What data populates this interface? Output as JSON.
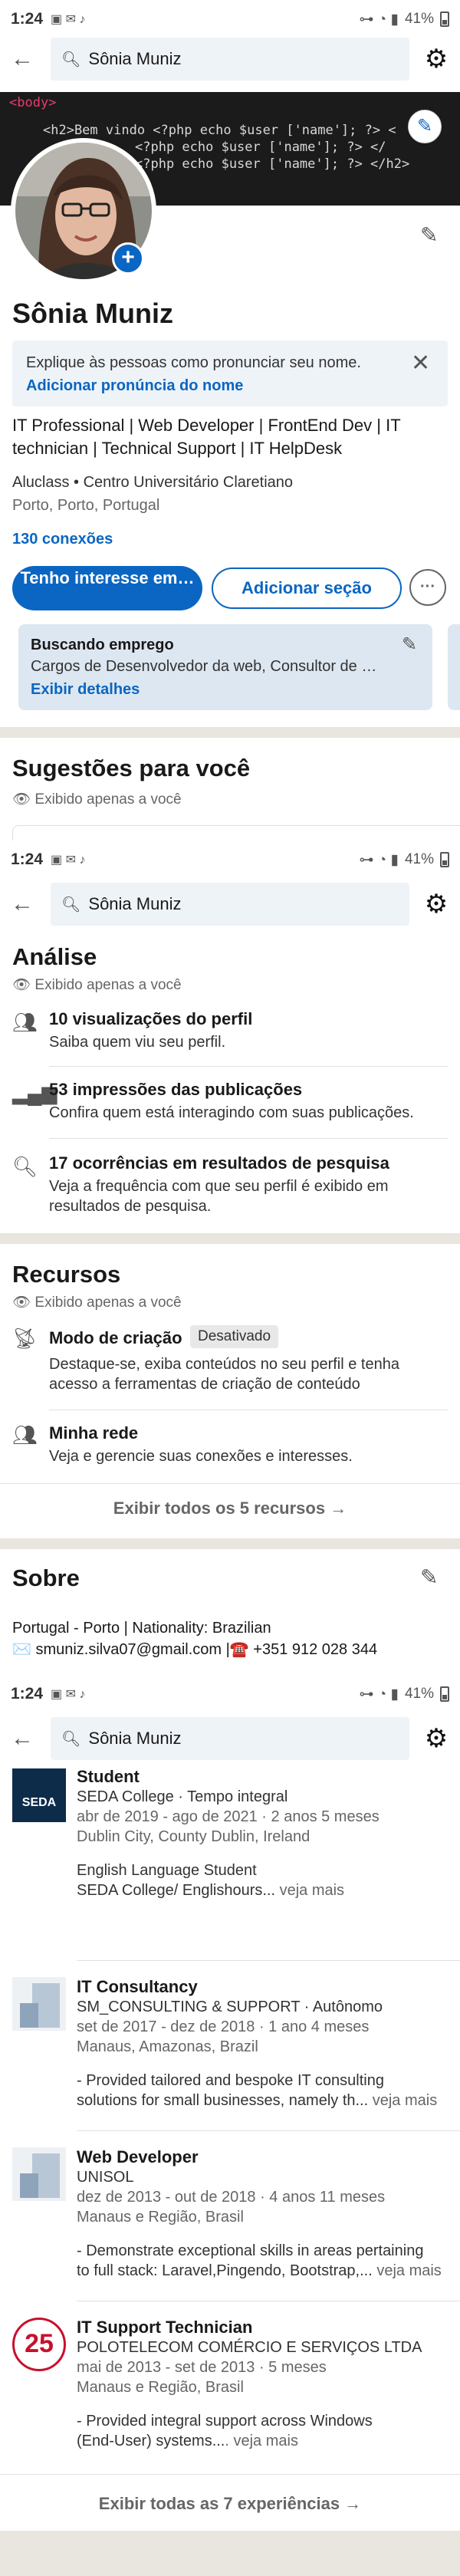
{
  "status_bars": [
    {
      "time": "1:24",
      "battery": "41%"
    },
    {
      "time": "1:24",
      "battery": "41%"
    },
    {
      "time": "1:24",
      "battery": "41%"
    }
  ],
  "search": {
    "value": "Sônia Muniz"
  },
  "cover": {
    "tag": "<body>",
    "lines": [
      "<h2>Bem vindo <?php echo $user ['name']; ?> <",
      "<?php echo $user ['name']; ?> </",
      "<?php echo $user ['name']; ?> </h2>"
    ]
  },
  "profile": {
    "name": "Sônia Muniz",
    "pronunciation_prompt": "Explique às pessoas como pronunciar seu nome.",
    "pronunciation_link": "Adicionar pronúncia do nome",
    "headline": "IT Professional | Web Developer | FrontEnd Dev | IT technician | Technical Support | IT HelpDesk",
    "education": "Aluclass • Centro Universitário Claretiano",
    "location": "Porto, Porto, Portugal",
    "connections": "130 conexões",
    "btn_interest": "Tenho interesse em…",
    "btn_add_section": "Adicionar seção",
    "btn_more": "···"
  },
  "open_to_work": {
    "title": "Buscando emprego",
    "roles": "Cargos de Desenvolvedor da web, Consultor de …",
    "details": "Exibir detalhes"
  },
  "suggestions": {
    "title": "Sugestões para você",
    "visibility": "Exibido apenas a você"
  },
  "analytics": {
    "title": "Análise",
    "visibility": "Exibido apenas a você",
    "items": [
      {
        "title": "10 visualizações do perfil",
        "desc": "Saiba quem viu seu perfil."
      },
      {
        "title": "53 impressões das publicações",
        "desc": "Confira quem está interagindo com suas publicações."
      },
      {
        "title": "17 ocorrências em resultados de pesquisa",
        "desc": "Veja a frequência com que seu perfil é exibido em resultados de pesquisa."
      }
    ]
  },
  "resources": {
    "title": "Recursos",
    "visibility": "Exibido apenas a você",
    "creator_title": "Modo de criação",
    "creator_badge": "Desativado",
    "creator_desc": "Destaque-se, exiba conteúdos no seu perfil e tenha acesso a ferramentas de criação de conteúdo",
    "network_title": "Minha rede",
    "network_desc": "Veja e gerencie suas conexões e interesses.",
    "show_all": "Exibir todos os 5 recursos →"
  },
  "about": {
    "title": "Sobre",
    "line1": "Portugal - Porto | Nationality: Brazilian",
    "line2": "✉️ smuniz.silva07@gmail.com |☎️ +351 912 028 344"
  },
  "experience": {
    "items": [
      {
        "title": "Student",
        "company": "SEDA College · Tempo integral",
        "dates": "abr de 2019 - ago de 2021 · 2 anos 5 meses",
        "location": "Dublin City, County Dublin, Ireland",
        "desc1": "English Language Student",
        "desc2": "SEDA College/ Englishours...",
        "more": " veja mais",
        "logo_text": "SEDA"
      },
      {
        "title": "IT Consultancy",
        "company": "SM_CONSULTING & SUPPORT · Autônomo",
        "dates": "set de 2017 - dez de 2018 · 1 ano 4 meses",
        "location": "Manaus, Amazonas, Brazil",
        "desc1": "- Provided tailored and bespoke IT consulting",
        "desc2": "solutions for small businesses, namely th...",
        "more": " veja mais"
      },
      {
        "title": "Web Developer",
        "company": "UNISOL",
        "dates": "dez de 2013 - out de 2018 · 4 anos 11 meses",
        "location": "Manaus e Região, Brasil",
        "desc1": "-  Demonstrate exceptional skills in areas pertaining",
        "desc2": "to full stack: Laravel,Pingendo, Bootstrap,...",
        "more": " veja mais"
      },
      {
        "title": "IT Support Technician",
        "company": "POLOTELECOM COMÉRCIO E SERVIÇOS  LTDA",
        "dates": "mai de 2013 - set de 2013 · 5 meses",
        "location": "Manaus e Região, Brasil",
        "desc1": "- Provided integral support across Windows",
        "desc2": "(End-User) systems...",
        "more": ". veja mais",
        "logo_text": "25"
      }
    ],
    "show_all": "Exibir todas as 7 experiências →"
  },
  "colors": {
    "accent": "#0a66c2",
    "divider": "#e9e5df",
    "search_bg": "#eef3f8"
  }
}
